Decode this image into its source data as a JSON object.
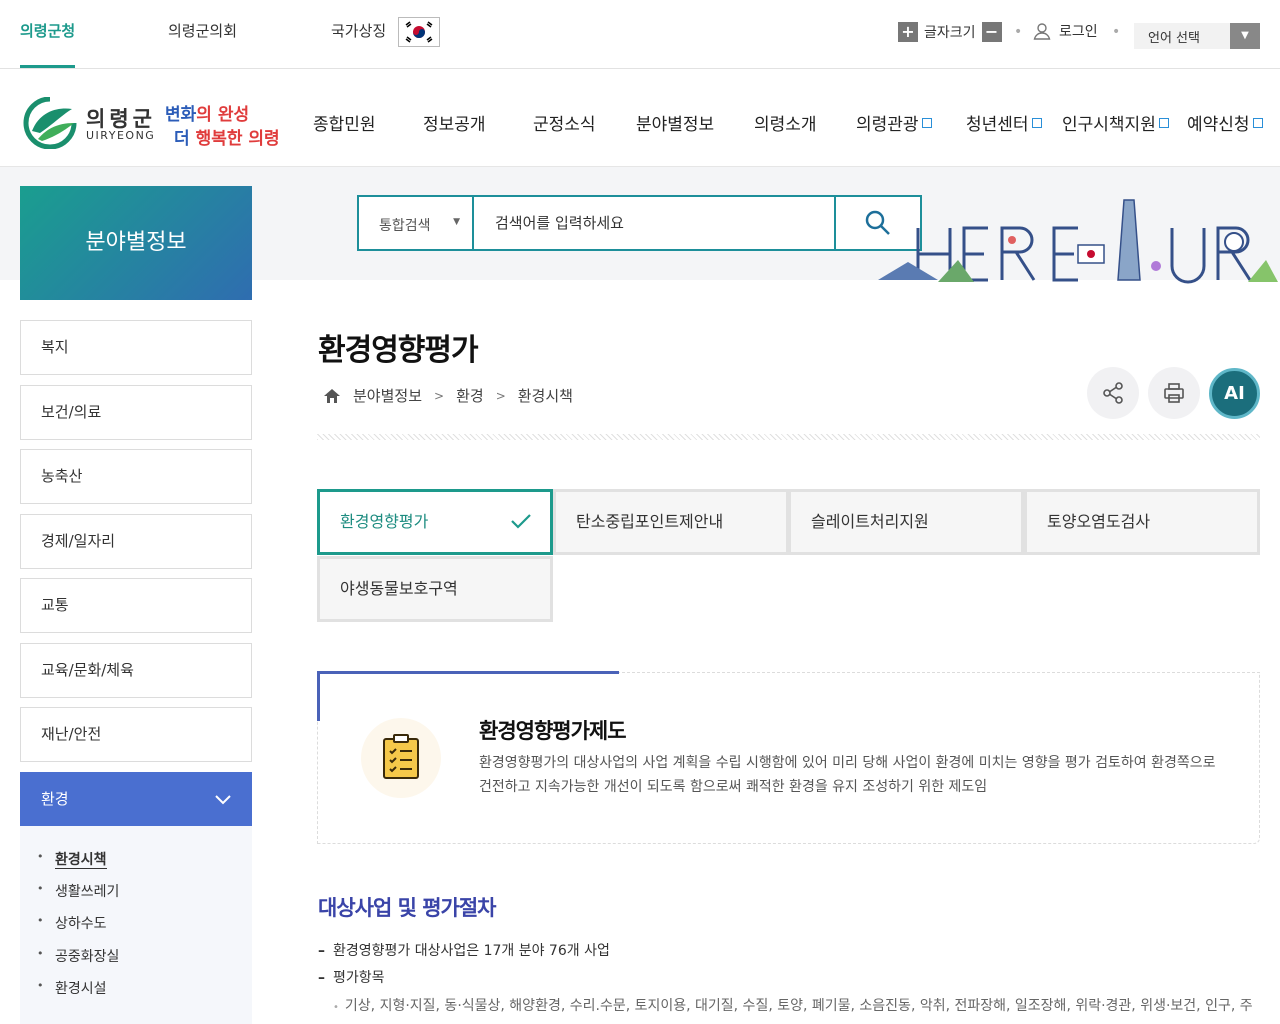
{
  "topbar": {
    "links": [
      "의령군청",
      "의령군의회",
      "국가상징"
    ],
    "fontsize_label": "글자크기",
    "plus": "+",
    "minus": "−",
    "login": "로그인",
    "language": "언어 선택",
    "dot": "•"
  },
  "logo": {
    "name": "의령군",
    "english": "UIRYEONG",
    "slogan_line1_a": "변화",
    "slogan_line1_b": "의 완성",
    "slogan_line2_a": "더 ",
    "slogan_line2_b": "행복한 의령"
  },
  "gnb": [
    "종합민원",
    "정보공개",
    "군정소식",
    "분야별정보",
    "의령소개",
    "의령관광",
    "청년센터",
    "인구시책지원",
    "예약신청"
  ],
  "sidebar": {
    "title": "분야별정보",
    "items": [
      "복지",
      "보건/의료",
      "농축산",
      "경제/일자리",
      "교통",
      "교육/문화/체육",
      "재난/안전",
      "환경"
    ],
    "sub_items": [
      "환경시책",
      "생활쓰레기",
      "상하수도",
      "공중화장실",
      "환경시설"
    ]
  },
  "search": {
    "scope": "통합검색",
    "placeholder": "검색어를 입력하세요"
  },
  "page": {
    "title": "환경영향평가",
    "breadcrumb": [
      "분야별정보",
      "환경",
      "환경시책"
    ],
    "ai_label": "AI"
  },
  "tabs": [
    "환경영향평가",
    "탄소중립포인트제안내",
    "슬레이트처리지원",
    "토양오염도검사",
    "야생동물보호구역"
  ],
  "intro": {
    "title": "환경영향평가제도",
    "description": "환경영향평가의 대상사업의 사업 계획을 수립 시행함에 있어 미리 당해 사업이 환경에 미치는 영향을 평가 검토하여 환경쪽으로 건전하고 지속가능한 개선이 되도록 함으로써 쾌적한 환경을 유지 조성하기 위한 제도임"
  },
  "section": {
    "title": "대상사업 및 평가절차",
    "bullets": [
      "환경영향평가 대상사업은 17개 분야 76개 사업",
      "평가항목"
    ],
    "sub_bullet": "기상, 지형·지질, 동·식물상, 해양환경, 수리.수문, 토지이용, 대기질, 수질, 토양, 폐기물, 소음진동, 악취, 전파장해, 일조장해, 위락·경관, 위생·보건, 인구, 주거, 산업, 공공시설, 교육, 교통, 문화재도"
  },
  "colors": {
    "accent": "#1d9a8c",
    "active_menu": "#4a6fd0",
    "section_title": "#3a44a8"
  }
}
